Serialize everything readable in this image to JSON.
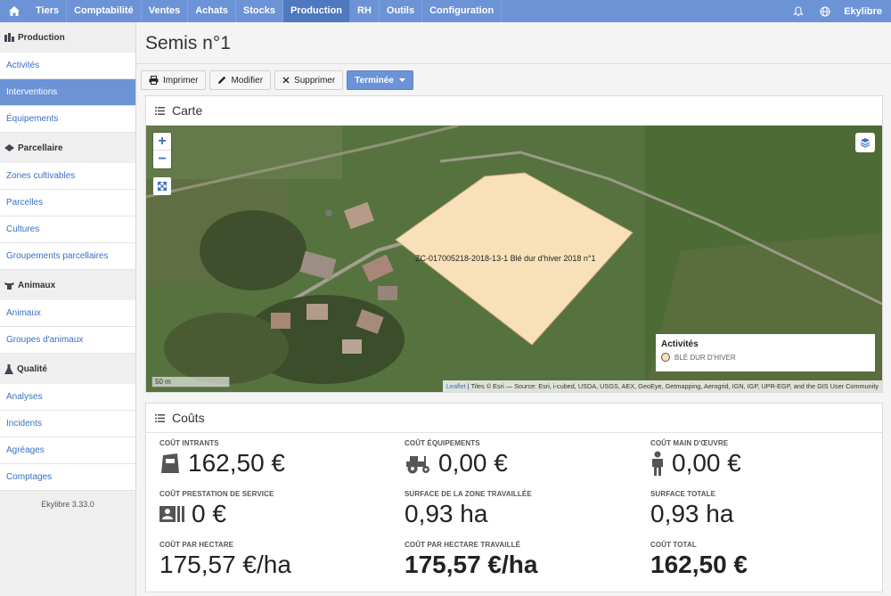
{
  "nav": {
    "items": [
      "Tiers",
      "Comptabilité",
      "Ventes",
      "Achats",
      "Stocks",
      "Production",
      "RH",
      "Outils",
      "Configuration"
    ],
    "active": "Production",
    "user": "Ekylibre"
  },
  "sidebar": {
    "sections": [
      {
        "title": "Production",
        "items": [
          "Activités",
          "Interventions",
          "Équipements"
        ]
      },
      {
        "title": "Parcellaire",
        "items": [
          "Zones cultivables",
          "Parcelles",
          "Cultures",
          "Groupements parcellaires"
        ]
      },
      {
        "title": "Animaux",
        "items": [
          "Animaux",
          "Groupes d'animaux"
        ]
      },
      {
        "title": "Qualité",
        "items": [
          "Analyses",
          "Incidents",
          "Agréages",
          "Comptages"
        ]
      }
    ],
    "active_item": "Interventions",
    "version": "Ekylibre 3.33.0"
  },
  "page": {
    "title": "Semis n°1"
  },
  "toolbar": {
    "print": "Imprimer",
    "edit": "Modifier",
    "delete": "Supprimer",
    "state": "Terminée"
  },
  "map_panel": {
    "title": "Carte",
    "zoom_in": "+",
    "zoom_out": "−",
    "field_label": "ZC-017005218-2018-13-1 Blé dur d'hiver 2018 n°1",
    "legend_title": "Activités",
    "legend_item": "BLÉ DUR D'HIVER",
    "legend_color": "#f8e1b9",
    "scale": "50 m",
    "attribution_link": "Leaflet",
    "attribution_text": " | Tiles © Esri — Source: Esri, i-cubed, USDA, USGS, AEX, GeoEye, Getmapping, Aerogrid, IGN, IGP, UPR-EGP, and the GIS User Community"
  },
  "costs_panel": {
    "title": "Coûts",
    "items": [
      {
        "label": "COÛT INTRANTS",
        "value": "162,50 €",
        "icon": "bag-icon"
      },
      {
        "label": "COÛT ÉQUIPEMENTS",
        "value": "0,00 €",
        "icon": "tractor-icon"
      },
      {
        "label": "COÛT MAIN D'ŒUVRE",
        "value": "0,00 €",
        "icon": "person-icon"
      },
      {
        "label": "COÛT PRESTATION DE SERVICE",
        "value": "0 €",
        "icon": "id-card-icon"
      },
      {
        "label": "SURFACE DE LA ZONE TRAVAILLÉE",
        "value": "0,93 ha"
      },
      {
        "label": "SURFACE TOTALE",
        "value": "0,93 ha"
      },
      {
        "label": "COÛT PAR HECTARE",
        "value": "175,57 €/ha"
      },
      {
        "label": "COÛT PAR HECTARE TRAVAILLÉ",
        "value": "175,57 €/ha"
      },
      {
        "label": "COÛT TOTAL",
        "value": "162,50 €"
      }
    ]
  }
}
